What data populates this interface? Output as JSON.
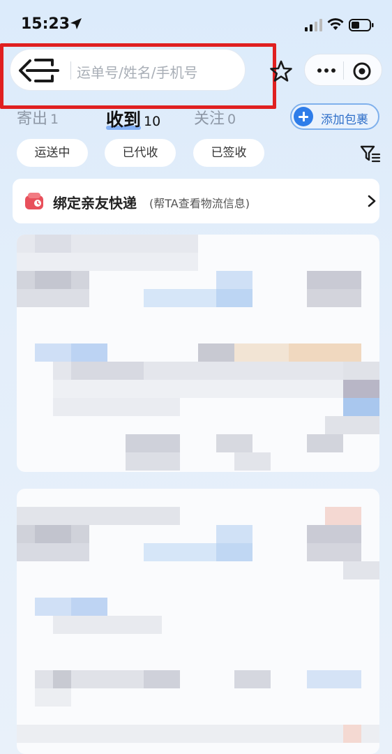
{
  "status_bar": {
    "time": "15:23"
  },
  "search": {
    "placeholder": "运单号/姓名/手机号"
  },
  "tabs": [
    {
      "label": "寄出",
      "count": "1"
    },
    {
      "label": "收到",
      "count": "10"
    },
    {
      "label": "关注",
      "count": "0"
    }
  ],
  "add_package": {
    "label": "添加包裹"
  },
  "filters": [
    {
      "label": "运送中"
    },
    {
      "label": "已代收"
    },
    {
      "label": "已签收"
    }
  ],
  "bind_card": {
    "title": "绑定亲友快递",
    "subtitle": "(帮TA查看物流信息)"
  },
  "colors": {
    "accent": "#2f7de9",
    "highlight_border": "#e02020",
    "bind_icon": "#e8505b"
  }
}
